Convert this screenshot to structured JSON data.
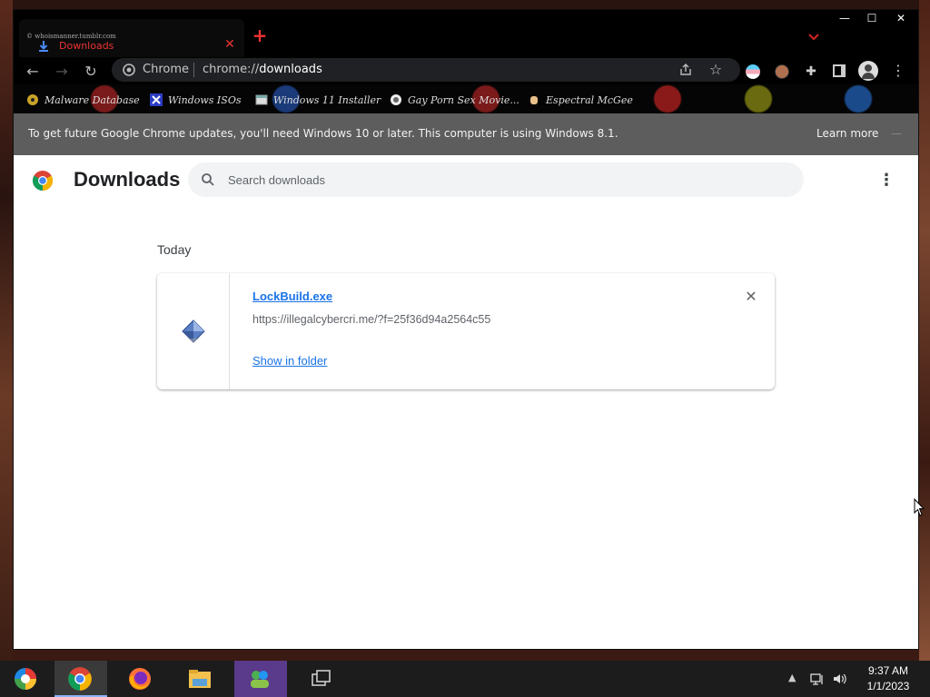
{
  "browser": {
    "tab": {
      "watermark": "© whoismanner.tumblr.com",
      "title": "Downloads",
      "close": "✕"
    },
    "new_tab": "+",
    "window_buttons": {
      "minimize": "—",
      "maximize": "☐",
      "close": "✕"
    },
    "toolbar": {
      "site_chip": "Chrome",
      "url_prefix": "chrome://",
      "url_path": "downloads"
    },
    "bookmarks": [
      {
        "label": "Malware Database",
        "icon": "biohazard-icon"
      },
      {
        "label": "Windows ISOs",
        "icon": "x-logo-icon"
      },
      {
        "label": "Windows 11 Installer",
        "icon": "window-icon"
      },
      {
        "label": "Gay Porn Sex Movie...",
        "icon": "site-icon"
      },
      {
        "label": "Espectral McGee",
        "icon": "hand-icon"
      }
    ],
    "infobar": {
      "message": "To get future Google Chrome updates, you'll need Windows 10 or later. This computer is using Windows 8.1.",
      "learn_more": "Learn more"
    }
  },
  "downloads_page": {
    "title": "Downloads",
    "search_placeholder": "Search downloads",
    "sections": [
      {
        "date": "Today",
        "items": [
          {
            "file_name": "LockBuild.exe",
            "url": "https://illegalcybercri.me/?f=25f36d94a2564c55",
            "action": "Show in folder"
          }
        ]
      }
    ]
  },
  "taskbar": {
    "apps": [
      "start",
      "chrome",
      "firefox",
      "file-explorer",
      "messenger",
      "task-view"
    ],
    "time": "9:37 AM",
    "date": "1/1/2023"
  },
  "colors": {
    "link": "#1a73e8",
    "infobar_bg": "#5d5d5d",
    "tab_text": "#e33333"
  }
}
